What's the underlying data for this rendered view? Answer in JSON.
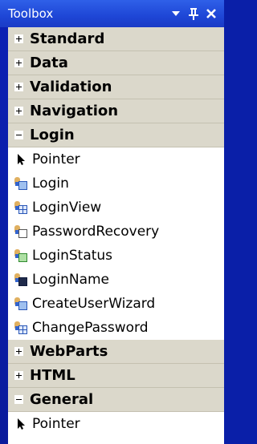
{
  "window": {
    "title": "Toolbox"
  },
  "groups": [
    {
      "label": "Standard",
      "expanded": false
    },
    {
      "label": "Data",
      "expanded": false
    },
    {
      "label": "Validation",
      "expanded": false
    },
    {
      "label": "Navigation",
      "expanded": false
    },
    {
      "label": "Login",
      "expanded": true,
      "items": [
        {
          "label": "Pointer",
          "icon": "pointer-icon"
        },
        {
          "label": "Login",
          "icon": "login-icon"
        },
        {
          "label": "LoginView",
          "icon": "loginview-icon"
        },
        {
          "label": "PasswordRecovery",
          "icon": "passwordrecovery-icon"
        },
        {
          "label": "LoginStatus",
          "icon": "loginstatus-icon"
        },
        {
          "label": "LoginName",
          "icon": "loginname-icon"
        },
        {
          "label": "CreateUserWizard",
          "icon": "createuserwizard-icon"
        },
        {
          "label": "ChangePassword",
          "icon": "changepassword-icon"
        }
      ]
    },
    {
      "label": "WebParts",
      "expanded": false
    },
    {
      "label": "HTML",
      "expanded": false
    },
    {
      "label": "General",
      "expanded": true,
      "items": [
        {
          "label": "Pointer",
          "icon": "pointer-icon"
        }
      ]
    }
  ]
}
